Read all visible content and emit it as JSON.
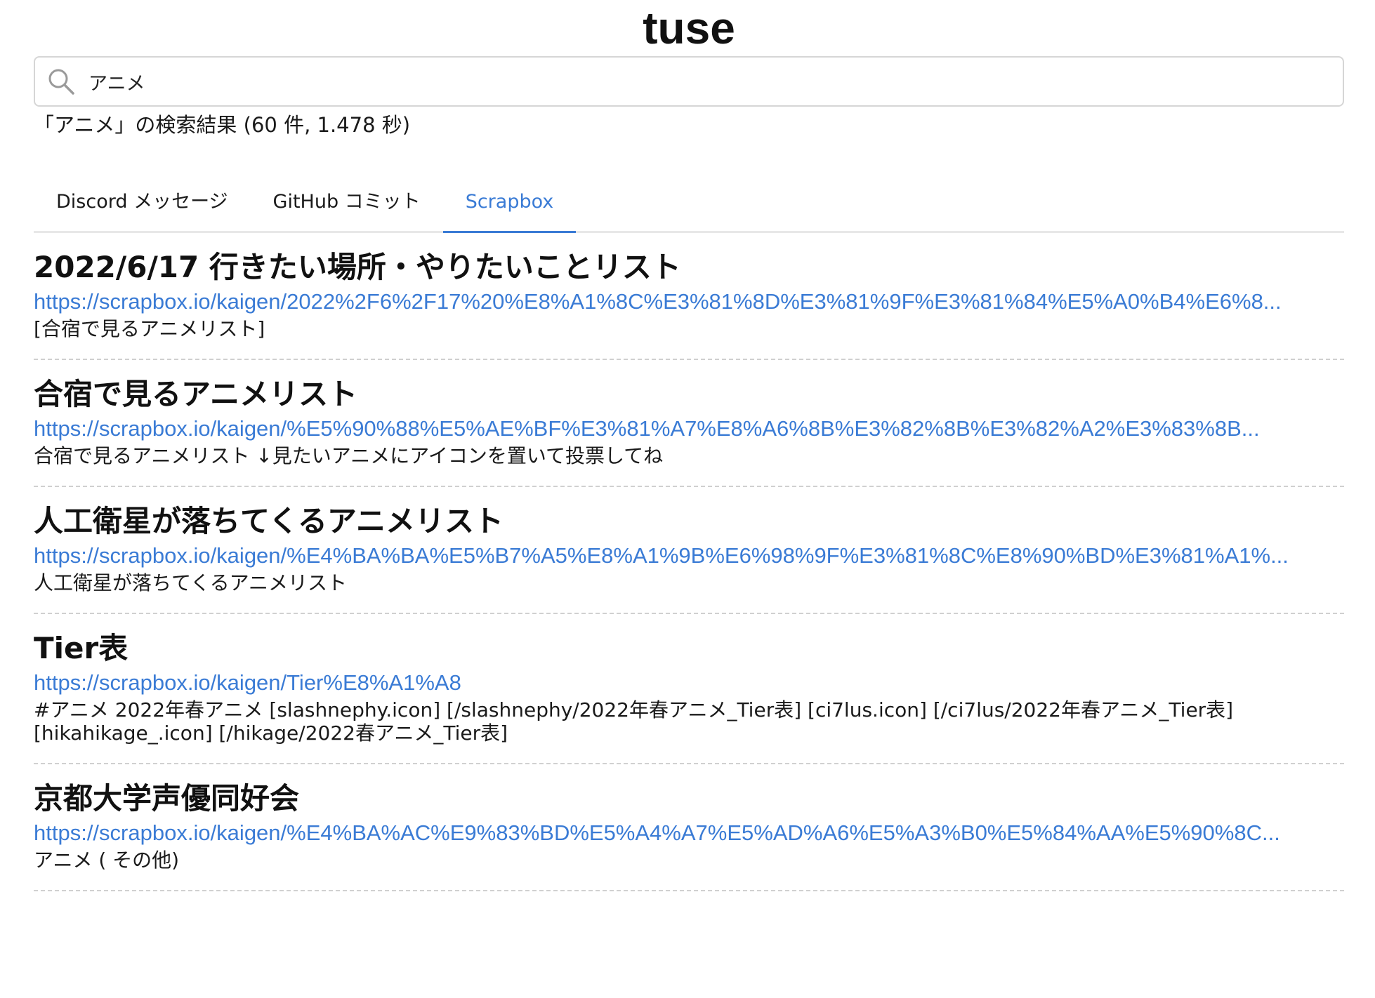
{
  "app": {
    "title": "tuse"
  },
  "search": {
    "value": "アニメ",
    "placeholder": ""
  },
  "summary": "「アニメ」の検索結果 (60 件, 1.478 秒)",
  "tabs": [
    {
      "label": "Discord メッセージ",
      "active": false
    },
    {
      "label": "GitHub コミット",
      "active": false
    },
    {
      "label": "Scrapbox",
      "active": true
    }
  ],
  "results": [
    {
      "title": "2022/6/17 行きたい場所・やりたいことリスト",
      "url": "https://scrapbox.io/kaigen/2022%2F6%2F17%20%E8%A1%8C%E3%81%8D%E3%81%9F%E3%81%84%E5%A0%B4%E6%8...",
      "snippet": "[合宿で見るアニメリスト]"
    },
    {
      "title": "合宿で見るアニメリスト",
      "url": "https://scrapbox.io/kaigen/%E5%90%88%E5%AE%BF%E3%81%A7%E8%A6%8B%E3%82%8B%E3%82%A2%E3%83%8B...",
      "snippet": "合宿で見るアニメリスト ↓見たいアニメにアイコンを置いて投票してね"
    },
    {
      "title": "人工衛星が落ちてくるアニメリスト",
      "url": "https://scrapbox.io/kaigen/%E4%BA%BA%E5%B7%A5%E8%A1%9B%E6%98%9F%E3%81%8C%E8%90%BD%E3%81%A1%...",
      "snippet": "人工衛星が落ちてくるアニメリスト"
    },
    {
      "title": "Tier表",
      "url": "https://scrapbox.io/kaigen/Tier%E8%A1%A8",
      "snippet": "#アニメ 2022年春アニメ [slashnephy.icon] [/slashnephy/2022年春アニメ_Tier表] [ci7lus.icon] [/ci7lus/2022年春アニメ_Tier表] [hikahikage_.icon] [/hikage/2022春アニメ_Tier表]"
    },
    {
      "title": "京都大学声優同好会",
      "url": "https://scrapbox.io/kaigen/%E4%BA%AC%E9%83%BD%E5%A4%A7%E5%AD%A6%E5%A3%B0%E5%84%AA%E5%90%8C...",
      "snippet": "アニメ ( その他)"
    }
  ],
  "colors": {
    "accent": "#3a7bd5",
    "border": "#d6d6d6",
    "divider": "#d0d0d0"
  },
  "icons": {
    "search": "search-icon"
  }
}
